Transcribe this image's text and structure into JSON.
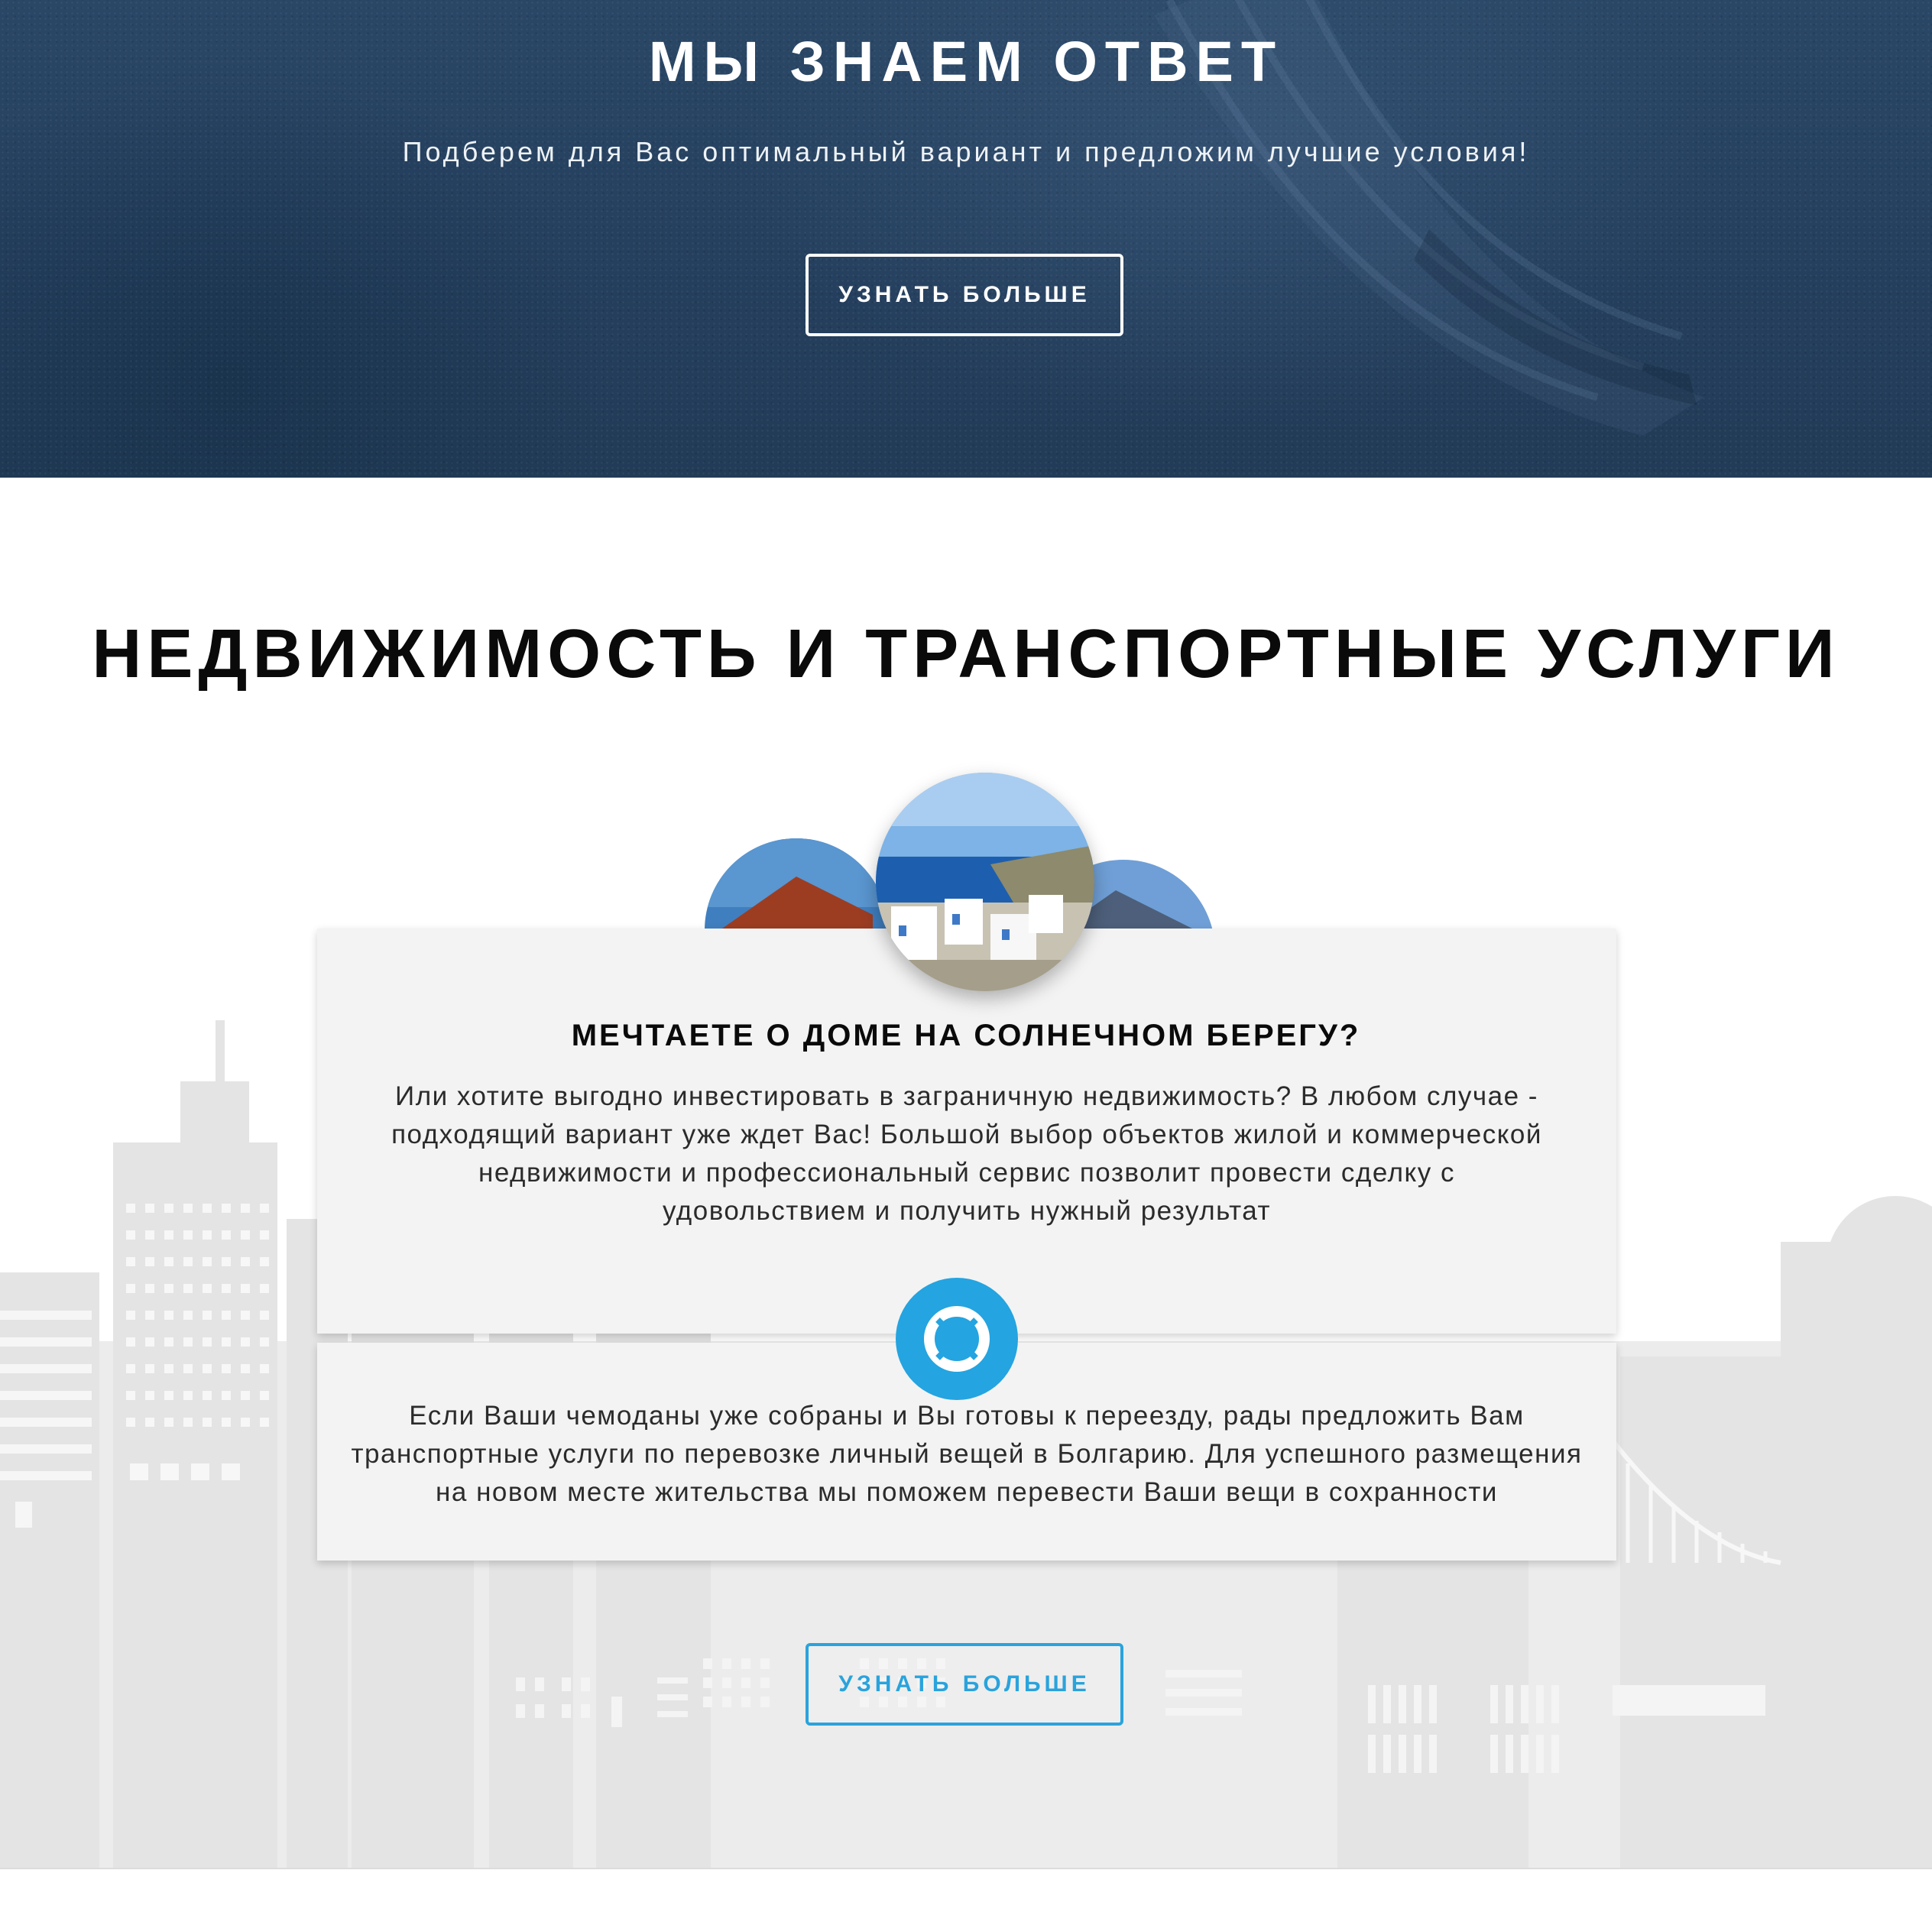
{
  "hero": {
    "title": "МЫ ЗНАЕМ ОТВЕТ",
    "subtitle": "Подберем для Вас оптимальный вариант и предложим лучшие условия!",
    "button_label": "УЗНАТЬ БОЛЬШЕ"
  },
  "services": {
    "title": "НЕДВИЖИМОСТЬ И ТРАНСПОРТНЫЕ УСЛУГИ",
    "real_estate": {
      "heading": "МЕЧТАЕТЕ О ДОМЕ НА СОЛНЕЧНОМ БЕРЕГУ?",
      "text": "Или хотите выгодно инвестировать в заграничную недвижимость? В любом случае - подходящий вариант уже ждет Вас! Большой выбор объектов жилой и коммерческой недвижимости и профессиональный сервис позволит провести сделку с удовольствием и получить нужный результат"
    },
    "transport": {
      "icon": "lifebuoy-icon",
      "text": "Если Ваши чемоданы уже собраны и Вы готовы к переезду, рады предложить Вам транспортные услуги по перевозке личный вещей в Болгарию. Для успешного размещения на новом месте жительства мы поможем перевести Ваши вещи в сохранности"
    },
    "button_label": "УЗНАТЬ БОЛЬШЕ"
  },
  "colors": {
    "hero_bg": "#243f5d",
    "accent": "#24a4e0",
    "card_bg": "#f3f3f3",
    "skyline": "#ebebeb"
  }
}
